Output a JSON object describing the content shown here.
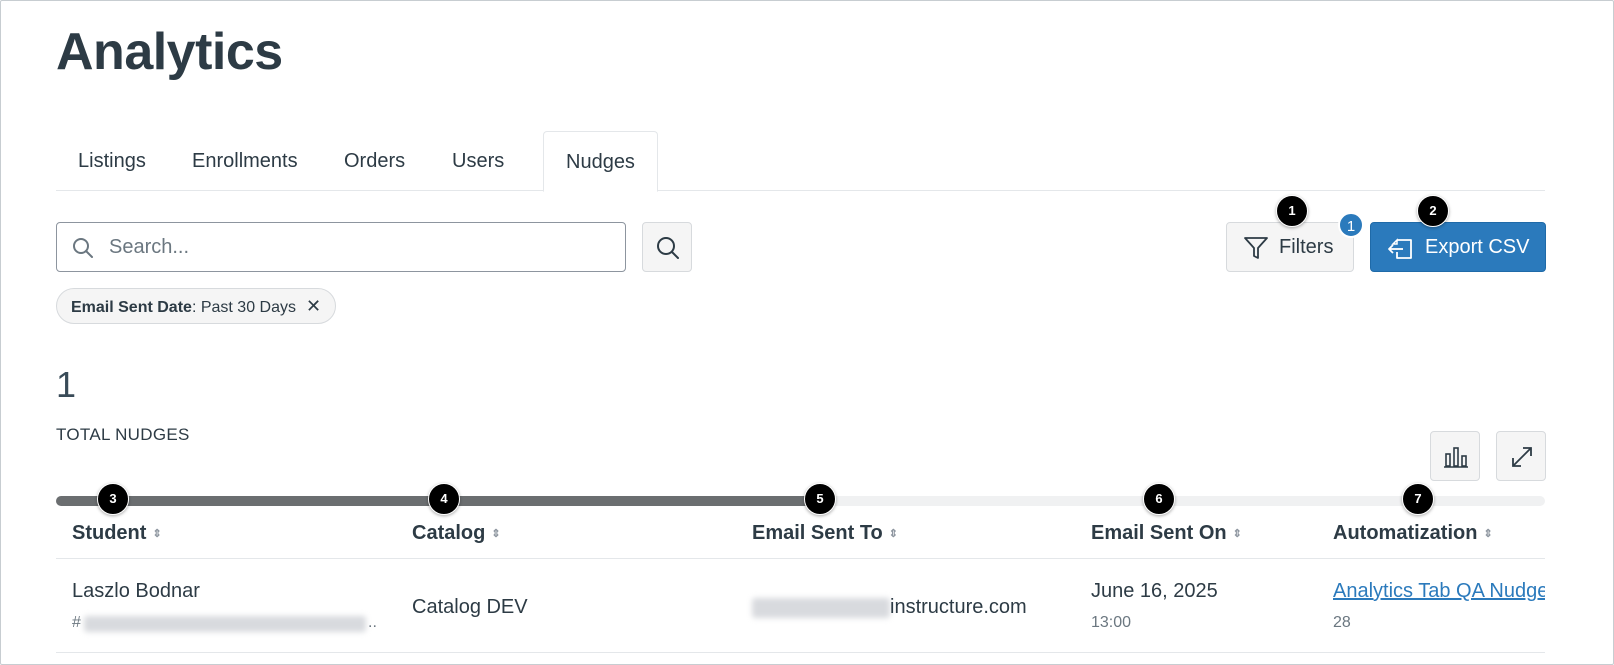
{
  "page": {
    "title": "Analytics"
  },
  "tabs": [
    {
      "label": "Listings"
    },
    {
      "label": "Enrollments"
    },
    {
      "label": "Orders"
    },
    {
      "label": "Users"
    },
    {
      "label": "Nudges",
      "active": true
    }
  ],
  "search": {
    "placeholder": "Search..."
  },
  "toolbar": {
    "filters_label": "Filters",
    "filters_count": "1",
    "export_label": "Export CSV"
  },
  "filter_chip": {
    "key": "Email Sent Date",
    "value": ": Past 30 Days",
    "remove": "✕"
  },
  "summary": {
    "total": "1",
    "label": "TOTAL NUDGES"
  },
  "markers": [
    "1",
    "2",
    "3",
    "4",
    "5",
    "6",
    "7"
  ],
  "table": {
    "columns": [
      "Student",
      "Catalog",
      "Email Sent To",
      "Email Sent On",
      "Automatization"
    ],
    "sort_glyph": "▲▼",
    "rows": [
      {
        "student": "Laszlo Bodnar",
        "student_sub_prefix": "#",
        "student_sub_suffix": "..",
        "catalog": "Catalog DEV",
        "email_domain": "instructure.com",
        "sent_date": "June 16, 2025",
        "sent_time": "13:00",
        "automatization": "Analytics Tab QA Nudge",
        "automatization_sub": "28"
      }
    ]
  },
  "colors": {
    "accent": "#2b7abc",
    "text": "#2d3b45",
    "marker": "#000000"
  }
}
